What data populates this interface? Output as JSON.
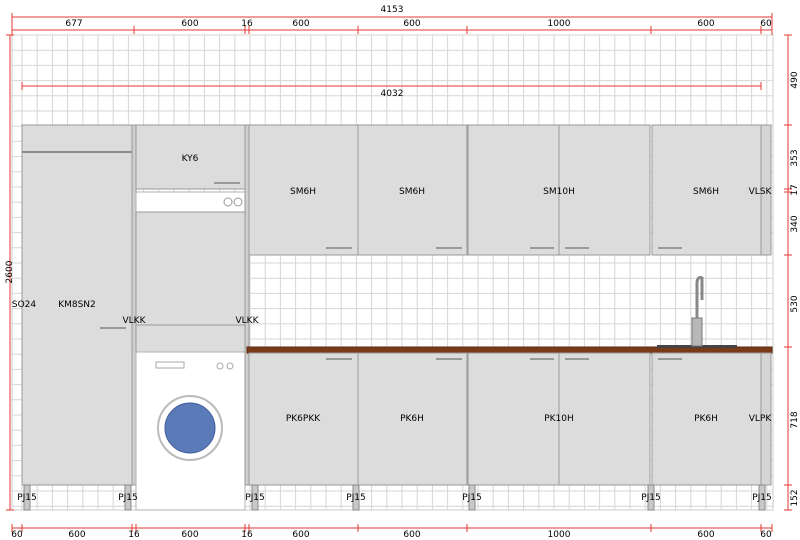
{
  "colors": {
    "dimension_line": "#e53935",
    "cabinet_fill": "#dcdcdc",
    "cabinet_edge": "#9a9a9a",
    "tile_line": "#d6d6d6",
    "countertop": "#7a3a18",
    "drum": "#5a7ab8"
  },
  "dimensions": {
    "overall_width": "4153",
    "wall_width": "4032",
    "height_total": "2600",
    "top_segments": [
      "677",
      "600",
      "16",
      "600",
      "600",
      "1000",
      "600",
      "60"
    ],
    "bottom_segments": [
      "60",
      "600",
      "16",
      "600",
      "16",
      "600",
      "600",
      "1000",
      "600",
      "60"
    ],
    "right_segments": [
      "490",
      "353",
      "17",
      "340",
      "530",
      "718",
      "152"
    ]
  },
  "cabinets": {
    "side_panel": "SO24",
    "fridge_tall": "KM8SN2",
    "tall_cover_left": "VLKK",
    "tall_cover_right": "VLKK",
    "above_washer": "KY6",
    "wall_1": "SM6H",
    "wall_2": "SM6H",
    "wall_3": "SM10H",
    "wall_4": "SM6H",
    "wall_end": "VLSK",
    "base_1": "PK6PKK",
    "base_2": "PK6H",
    "base_3": "PK10H",
    "base_4": "PK6H",
    "base_end": "VLPK"
  },
  "legs": [
    "PJ15",
    "PJ15",
    "PJ15",
    "PJ15",
    "PJ15",
    "PJ15",
    "PJ15"
  ],
  "icons": {
    "faucet": "faucet-icon",
    "washer": "washing-machine-icon"
  }
}
